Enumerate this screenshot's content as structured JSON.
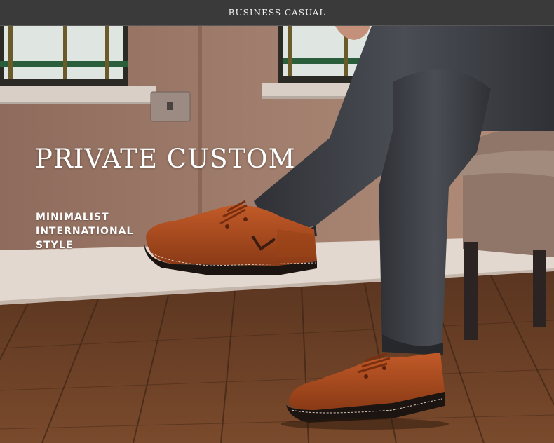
{
  "header": {
    "title": "BUSINESS CASUAL"
  },
  "hero": {
    "headline": "PRIVATE CUSTOM",
    "tagline_lines": [
      "MINIMALIST",
      "INTERNATIONAL",
      "STYLE"
    ]
  },
  "colors": {
    "header_bar": "#3a3a3a",
    "wall": "#9a7666",
    "floor": "#6b3f24",
    "shoe_leather": "#a84a1e",
    "jeans": "#3b3d42"
  }
}
